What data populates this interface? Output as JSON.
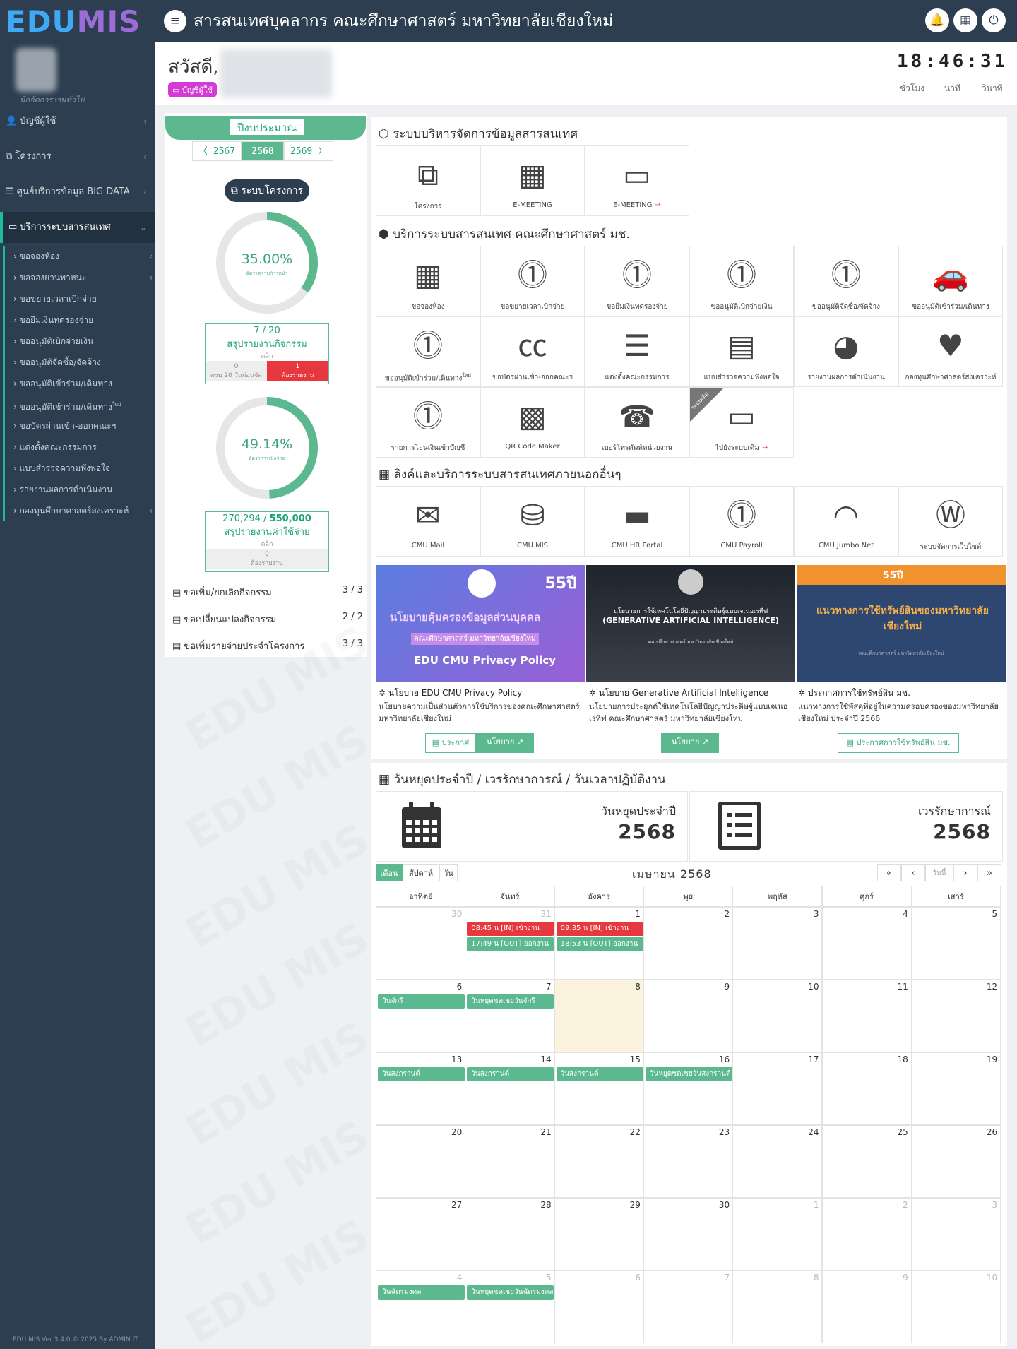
{
  "app": {
    "logo_part1": "EDU",
    "logo_part2": "MIS",
    "title": "สารสนเทศบุคลากร คณะศึกษาศาสตร์ มหาวิทยาลัยเชียงใหม่",
    "version": "EDU MIS Ver 3.4.0 © 2025 By ADMIN IT"
  },
  "user": {
    "greeting": "สวัสดี,",
    "role": "นักจัดการงานทั่วไป",
    "account_badge": "บัญชีผู้ใช้"
  },
  "clock": {
    "time": "18:46:31",
    "hour_label": "ชั่วโมง",
    "minute_label": "นาที",
    "second_label": "วินาที"
  },
  "sidebar": {
    "items": [
      {
        "label": "บัญชีผู้ใช้"
      },
      {
        "label": "โครงการ"
      },
      {
        "label": "ศูนย์บริการข้อมูล BIG DATA"
      },
      {
        "label": "บริการระบบสารสนเทศ"
      }
    ],
    "subitems": [
      "ขอจองห้อง",
      "ขอจองยานพาหนะ",
      "ขอขยายเวลาเบิกจ่าย",
      "ขอยืมเงินทดรองจ่าย",
      "ขออนุมัติเบิกจ่ายเงิน",
      "ขออนุมัติจัดซื้อ/จัดจ้าง",
      "ขออนุมัติเข้าร่วม/เดินทาง",
      "ขออนุมัติเข้าร่วม/เดินทาง",
      "ขอบัตรผ่านเข้า-ออกคณะฯ",
      "แต่งตั้งคณะกรรมการ",
      "แบบสำรวจความพึงพอใจ",
      "รายงานผลการดำเนินงาน",
      "กองทุนศึกษาศาสตร์สงเคราะห์"
    ],
    "sub7_sup": "ใหม่"
  },
  "budget": {
    "label": "ปีงบประมาณ",
    "prev": "〈 2567",
    "current": "2568",
    "next": "2569 〉",
    "system_button": "ระบบโครงการ"
  },
  "progress": {
    "value": 35.0,
    "text": "35.00%",
    "sub": "อัตราความก้าวหน้า"
  },
  "activity": {
    "count": "7 / 20",
    "title": "สรุปรายงานกิจกรรม",
    "click": "คลิก",
    "done_count": "0",
    "done_label": "ครบ 20 วันก่อนจัด",
    "pending_count": "1",
    "pending_label": "ต้องรายงาน"
  },
  "spending": {
    "value": 49.14,
    "text": "49.14%",
    "sub": "อัตราการเบิกจ่าย"
  },
  "expense": {
    "used": "270,294",
    "total": "550,000",
    "title": "สรุปรายงานค่าใช้จ่าย",
    "click": "คลิก",
    "pending_count": "0",
    "pending_label": "ต้องรายงาน"
  },
  "requests": [
    {
      "label": "ขอเพิ่ม/ยกเลิกกิจกรรม",
      "count": "3 / 3"
    },
    {
      "label": "ขอเปลี่ยนแปลงกิจกรรม",
      "count": "2 / 2"
    },
    {
      "label": "ขอเพิ่มรายจ่ายประจำโครงการ",
      "count": "3 / 3"
    }
  ],
  "sections": {
    "mis": "ระบบบริหารจัดการข้อมูลสารสนเทศ",
    "services": "บริการระบบสารสนเทศ คณะศึกษาศาสตร์ มช.",
    "links": "ลิงค์และบริการระบบสารสนเทศภายนอกอื่นๆ",
    "calendar": "วันหยุดประจำปี / เวรรักษาการณ์ / วันเวลาปฏิบัติงาน"
  },
  "mis_tiles": [
    {
      "label": "โครงการ",
      "icon": "copy-icon"
    },
    {
      "label": "E-MEETING",
      "icon": "calendar-icon"
    },
    {
      "label": "E-MEETING",
      "icon": "monitor-icon",
      "arrow": "→"
    }
  ],
  "service_tiles": [
    {
      "label": "ขอจองห้อง",
      "icon": "calendar-icon"
    },
    {
      "label": "ขอขยายเวลาเบิกจ่าย",
      "icon": "money-icon"
    },
    {
      "label": "ขอยืมเงินทดรองจ่าย",
      "icon": "money-icon"
    },
    {
      "label": "ขออนุมัติเบิกจ่ายเงิน",
      "icon": "money-icon"
    },
    {
      "label": "ขออนุมัติจัดซื้อ/จัดจ้าง",
      "icon": "money-icon"
    },
    {
      "label": "ขออนุมัติเข้าร่วม/เดินทาง",
      "icon": "car-icon"
    },
    {
      "label": "ขออนุมัติเข้าร่วม/เดินทาง",
      "icon": "money-icon",
      "sup": "ใหม่"
    },
    {
      "label": "ขอบัตรผ่านเข้า-ออกคณะฯ",
      "icon": "cc-icon"
    },
    {
      "label": "แต่งตั้งคณะกรรมการ",
      "icon": "list-icon"
    },
    {
      "label": "แบบสำรวจความพึงพอใจ",
      "icon": "list-alt-icon"
    },
    {
      "label": "รายงานผลการดำเนินงาน",
      "icon": "pie-chart-icon"
    },
    {
      "label": "กองทุนศึกษาศาสตร์สงเคราะห์",
      "icon": "heartbeat-icon"
    },
    {
      "label": "รายการโอนเงินเข้าบัญชี",
      "icon": "money-icon"
    },
    {
      "label": "QR Code Maker",
      "icon": "qrcode-icon"
    },
    {
      "label": "เบอร์โทรศัพท์หน่วยงาน",
      "icon": "phone-icon"
    },
    {
      "label": "ไปยังระบบเดิม",
      "icon": "monitor-icon",
      "ribbon": "ระบบเดิม",
      "arrow": "→"
    }
  ],
  "link_tiles": [
    {
      "label": "CMU Mail",
      "icon": "envelope-icon"
    },
    {
      "label": "CMU MIS",
      "icon": "database-icon"
    },
    {
      "label": "CMU HR Portal",
      "icon": "credit-card-icon"
    },
    {
      "label": "CMU Payroll",
      "icon": "money-icon"
    },
    {
      "label": "CMU Jumbo Net",
      "icon": "wifi-icon"
    },
    {
      "label": "ระบบจัดการเว็บไซต์",
      "icon": "wordpress-icon"
    }
  ],
  "banners": [
    {
      "heading": "นโยบายคุ้มครองข้อมูลส่วนบุคคล",
      "subheading": "คณะศึกษาศาสตร์ มหาวิทยาลัยเชียงใหม่",
      "footer": "EDU CMU Privacy Policy",
      "anniv": "55ปี",
      "caption": "นโยบาย EDU CMU Privacy Policy",
      "desc": "นโยบายความเป็นส่วนตัวการใช้บริการของคณะศึกษาศาสตร์ มหาวิทยาลัยเชียงใหม่",
      "btn1": "ประกาศ",
      "btn2": "นโยบาย"
    },
    {
      "heading": "นโยบายการใช้เทคโนโลยีปัญญาประดิษฐ์แบบเจเนอเรทีฟ",
      "subheading": "(GENERATIVE ARTIFICIAL INTELLIGENCE)",
      "footer": "คณะศึกษาศาสตร์ มหาวิทยาลัยเชียงใหม่",
      "caption": "นโยบาย Generative Artificial Intelligence",
      "desc": "นโยบายการประยุกต์ใช้เทคโนโลยีปัญญาประดิษฐ์แบบเจเนอเรทีฟ คณะศึกษาศาสตร์ มหาวิทยาลัยเชียงใหม่",
      "btn1": "นโยบาย"
    },
    {
      "heading": "แนวทางการใช้ทรัพย์สินของมหาวิทยาลัยเชียงใหม่",
      "footer": "คณะศึกษาศาสตร์ มหาวิทยาลัยเชียงใหม่",
      "anniv": "55ปี",
      "caption": "ประกาศการใช้ทรัพย์สิน มช.",
      "desc": "แนวทางการใช้พัสดุที่อยู่ในความครอบครองของมหาวิทยาลัยเชียงใหม่ ประจำปี 2566",
      "btn1": "ประกาศการใช้ทรัพย์สิน มช."
    }
  ],
  "stats": {
    "holiday_label": "วันหยุดประจำปี",
    "holiday_year": "2568",
    "guard_label": "เวรรักษาการณ์",
    "guard_year": "2568"
  },
  "calendar": {
    "title": "เมษายน 2568",
    "views": [
      "เดือน",
      "สัปดาห์",
      "วัน"
    ],
    "nav": [
      "«",
      "‹",
      "วันนี้",
      "›",
      "»"
    ],
    "weekdays": [
      "อาทิตย์",
      "จันทร์",
      "อังคาร",
      "พุธ",
      "พฤหัส",
      "ศุกร์",
      "เสาร์"
    ],
    "weeks": [
      [
        {
          "d": "30",
          "other": true
        },
        {
          "d": "31",
          "other": true,
          "events": [
            {
              "t": "08:45 น [IN] เข้างาน",
              "c": "r"
            },
            {
              "t": "17:49 น [OUT] ออกงาน",
              "c": "g"
            }
          ]
        },
        {
          "d": "1",
          "events": [
            {
              "t": "09:35 น [IN] เข้างาน",
              "c": "r"
            },
            {
              "t": "18:53 น [OUT] ออกงาน",
              "c": "g"
            }
          ]
        },
        {
          "d": "2"
        },
        {
          "d": "3"
        },
        {
          "d": "4"
        },
        {
          "d": "5"
        }
      ],
      [
        {
          "d": "6",
          "events": [
            {
              "t": "วันจักรี",
              "c": "g"
            }
          ]
        },
        {
          "d": "7",
          "events": [
            {
              "t": "วันหยุดชดเชยวันจักรี",
              "c": "g"
            }
          ]
        },
        {
          "d": "8",
          "today": true
        },
        {
          "d": "9"
        },
        {
          "d": "10"
        },
        {
          "d": "11"
        },
        {
          "d": "12"
        }
      ],
      [
        {
          "d": "13",
          "events": [
            {
              "t": "วันสงกรานต์",
              "c": "g"
            }
          ]
        },
        {
          "d": "14",
          "events": [
            {
              "t": "วันสงกรานต์",
              "c": "g"
            }
          ]
        },
        {
          "d": "15",
          "events": [
            {
              "t": "วันสงกรานต์",
              "c": "g"
            }
          ]
        },
        {
          "d": "16",
          "events": [
            {
              "t": "วันหยุดชดเชยวันสงกรานต์",
              "c": "g"
            }
          ]
        },
        {
          "d": "17"
        },
        {
          "d": "18"
        },
        {
          "d": "19"
        }
      ],
      [
        {
          "d": "20"
        },
        {
          "d": "21"
        },
        {
          "d": "22"
        },
        {
          "d": "23"
        },
        {
          "d": "24"
        },
        {
          "d": "25"
        },
        {
          "d": "26"
        }
      ],
      [
        {
          "d": "27"
        },
        {
          "d": "28"
        },
        {
          "d": "29"
        },
        {
          "d": "30"
        },
        {
          "d": "1",
          "other": true
        },
        {
          "d": "2",
          "other": true
        },
        {
          "d": "3",
          "other": true
        }
      ],
      [
        {
          "d": "4",
          "other": true,
          "events": [
            {
              "t": "วันฉัตรมงคล",
              "c": "g"
            }
          ]
        },
        {
          "d": "5",
          "other": true,
          "events": [
            {
              "t": "วันหยุดชดเชยวันฉัตรมงคล",
              "c": "g"
            }
          ]
        },
        {
          "d": "6",
          "other": true
        },
        {
          "d": "7",
          "other": true
        },
        {
          "d": "8",
          "other": true
        },
        {
          "d": "9",
          "other": true
        },
        {
          "d": "10",
          "other": true
        }
      ]
    ]
  },
  "colors": {
    "topbar": "#2c3e50",
    "accent": "#5cb88f",
    "danger": "#e7373f",
    "badge": "#d63ad6"
  }
}
